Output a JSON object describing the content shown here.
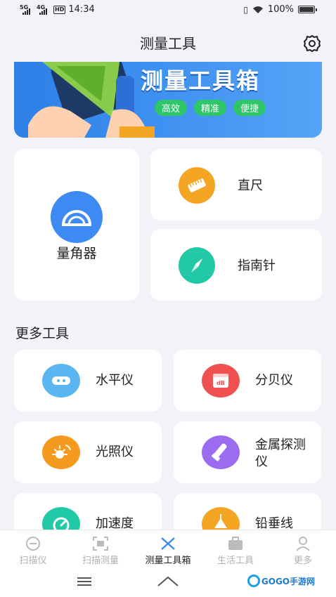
{
  "status": {
    "time": "14:34",
    "net1": "5G",
    "net2": "4G",
    "hd": "HD",
    "battery": "100%"
  },
  "header": {
    "title": "测量工具"
  },
  "banner": {
    "title": "测量工具箱",
    "tags": [
      "高效",
      "精准",
      "便捷"
    ]
  },
  "main_tools": [
    {
      "label": "量角器",
      "icon": "protractor-icon",
      "color": "#3d8af2"
    },
    {
      "label": "直尺",
      "icon": "ruler-icon",
      "color": "#f5a524"
    },
    {
      "label": "指南针",
      "icon": "compass-icon",
      "color": "#22c9a6"
    }
  ],
  "more": {
    "title": "更多工具",
    "items": [
      {
        "label": "水平仪",
        "icon": "level-icon",
        "color": "#5ab6f0"
      },
      {
        "label": "分贝仪",
        "icon": "decibel-icon",
        "color": "#f05050",
        "badge": "dB"
      },
      {
        "label": "光照仪",
        "icon": "light-meter-icon",
        "color": "#f59a1f"
      },
      {
        "label": "金属探测仪",
        "icon": "metal-detector-icon",
        "color": "#9a6cf0"
      },
      {
        "label": "加速度",
        "icon": "accelerometer-icon",
        "color": "#22c9a6"
      },
      {
        "label": "铅垂线",
        "icon": "plumb-line-icon",
        "color": "#f5a524"
      }
    ]
  },
  "tabs": [
    {
      "label": "扫描仪",
      "icon": "scanner-icon"
    },
    {
      "label": "扫描测量",
      "icon": "scan-measure-icon"
    },
    {
      "label": "测量工具箱",
      "icon": "toolbox-icon",
      "active": true
    },
    {
      "label": "生活工具",
      "icon": "briefcase-icon"
    },
    {
      "label": "更多",
      "icon": "user-icon"
    }
  ],
  "watermark": "GOGO手游网"
}
